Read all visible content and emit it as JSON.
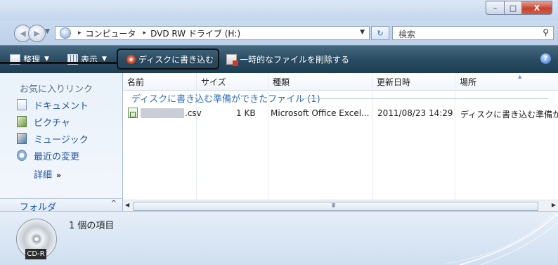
{
  "window": {
    "buttons": {
      "minimize": "–",
      "maximize": "□",
      "close": "X"
    }
  },
  "address": {
    "path": [
      "コンピュータ",
      "DVD RW ドライブ (H:)"
    ],
    "separator": "▸",
    "search_placeholder": "検索"
  },
  "toolbar": {
    "organize": "整理",
    "view": "表示",
    "burn": "ディスクに書き込む",
    "delete_temp": "一時的なファイルを削除する",
    "help": "?"
  },
  "nav": {
    "header": "お気に入りリンク",
    "links": [
      "ドキュメント",
      "ピクチャ",
      "ミュージック",
      "最近の変更"
    ],
    "more": "詳細",
    "more_chevron": "»",
    "folders": "フォルダ",
    "folders_toggle": "^"
  },
  "content": {
    "columns": [
      "名前",
      "サイズ",
      "種類",
      "更新日時",
      "場所"
    ],
    "group": "ディスクに書き込む準備ができたファイル (1)",
    "rows": [
      {
        "name": ".csv",
        "size": "1 KB",
        "type": "Microsoft Office Excel...",
        "modified": "2011/08/23 14:29",
        "location": "ディスクに書き込む準備か"
      }
    ],
    "scroll_grip": "Ⅲ"
  },
  "details": {
    "item_count": "1 個の項目",
    "disc_label": "CD-R"
  }
}
